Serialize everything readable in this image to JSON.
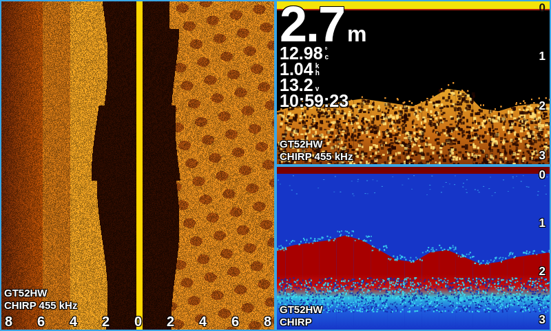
{
  "sidescan": {
    "label": "GT52HW",
    "frequency": "CHIRP 455 kHz",
    "scale": [
      "8",
      "6",
      "4",
      "2",
      "0",
      "2",
      "4",
      "6",
      "8"
    ]
  },
  "sonar": {
    "depth": "2.7",
    "depth_unit": "m",
    "readouts": [
      {
        "value": "12.98",
        "units": [
          "°",
          "c"
        ]
      },
      {
        "value": "1.04",
        "units": [
          "k",
          "h"
        ]
      },
      {
        "value": "13.2",
        "units": [
          "v"
        ]
      }
    ],
    "time": "10:59:23",
    "label": "GT52HW",
    "frequency": "CHIRP 455 kHz",
    "scale": [
      "0",
      "1",
      "2",
      "3"
    ],
    "bottom_depths": [
      2.1,
      2.0,
      2.0,
      1.95,
      1.9,
      1.85,
      1.9,
      1.95,
      2.0,
      1.85,
      1.65,
      1.7,
      2.05,
      2.1,
      2.0,
      1.95,
      1.95
    ]
  },
  "chirp": {
    "label": "GT52HW",
    "frequency": "CHIRP",
    "scale": [
      "0",
      "1",
      "2",
      "3"
    ],
    "bottom_depths": [
      1.55,
      1.45,
      1.4,
      1.35,
      1.25,
      1.35,
      1.55,
      1.75,
      1.8,
      1.6,
      1.55,
      1.7,
      1.85,
      1.8,
      1.7,
      1.65,
      1.6
    ]
  }
}
